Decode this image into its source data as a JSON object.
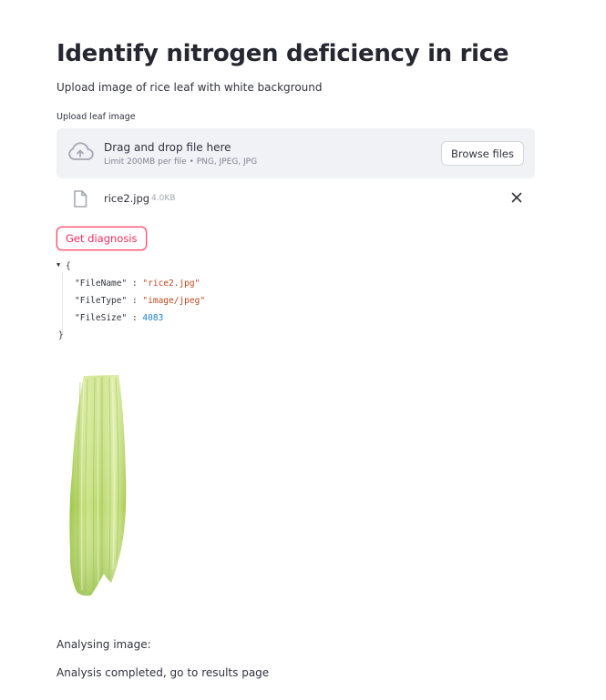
{
  "page": {
    "title": "Identify nitrogen deficiency in rice",
    "subtitle": "Upload image of rice leaf with white background"
  },
  "uploader": {
    "label": "Upload leaf image",
    "drop_text": "Drag and drop file here",
    "limit_text": "Limit 200MB per file • PNG, JPEG, JPG",
    "browse_label": "Browse files",
    "icon": "cloud-upload-icon"
  },
  "uploaded_file": {
    "name": "rice2.jpg",
    "size": "4.0KB",
    "icon": "file-icon",
    "remove_icon": "close-icon"
  },
  "actions": {
    "diagnosis_label": "Get diagnosis"
  },
  "json_view": {
    "open": "{",
    "close": "}",
    "sep": ":",
    "entries": [
      {
        "key": "\"FileName\"",
        "value": "\"rice2.jpg\""
      },
      {
        "key": "\"FileType\"",
        "value": "\"image/jpeg\""
      },
      {
        "key": "\"FileSize\"",
        "value": "4083"
      }
    ]
  },
  "colors": {
    "primary": "#ff4b4b",
    "dropzone_bg": "#f0f2f6",
    "text": "#31333f",
    "json_string": "#c0471c",
    "json_number": "#1f7fd1",
    "leaf_green": "#b6d66a"
  },
  "status": {
    "analysing": "Analysing image:",
    "completed": "Analysis completed, go to results page"
  }
}
